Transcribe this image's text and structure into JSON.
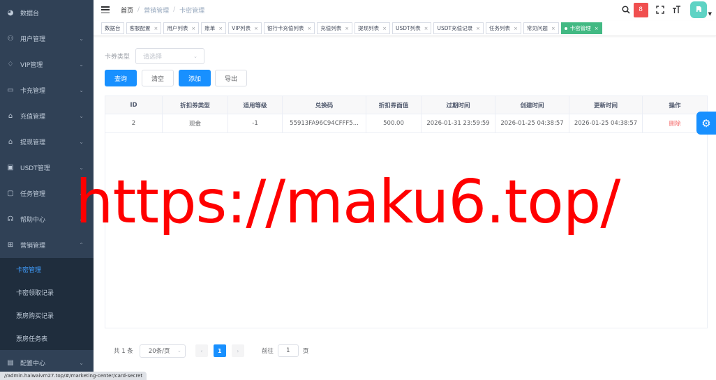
{
  "sidebar": {
    "items": [
      {
        "label": "数据台",
        "icon": "dashboard-icon",
        "chev": ""
      },
      {
        "label": "用户管理",
        "icon": "user-icon",
        "chev": "⌄"
      },
      {
        "label": "VIP管理",
        "icon": "vip-icon",
        "chev": "⌄"
      },
      {
        "label": "卡充管理",
        "icon": "card-icon",
        "chev": "⌄"
      },
      {
        "label": "充值管理",
        "icon": "recharge-icon",
        "chev": "⌄"
      },
      {
        "label": "提现管理",
        "icon": "withdraw-icon",
        "chev": "⌄"
      },
      {
        "label": "USDT管理",
        "icon": "usdt-icon",
        "chev": "⌄"
      },
      {
        "label": "任务管理",
        "icon": "task-icon",
        "chev": "⌄"
      },
      {
        "label": "帮助中心",
        "icon": "help-icon",
        "chev": "⌄"
      },
      {
        "label": "营销管理",
        "icon": "gift-icon",
        "chev": "⌃"
      }
    ],
    "submenu": [
      "卡密管理",
      "卡密领取记录",
      "票房购买记录",
      "票房任务表"
    ],
    "bottom": {
      "label": "配置中心",
      "icon": "config-icon",
      "chev": "⌄"
    }
  },
  "header": {
    "breadcrumb": [
      "首页",
      "营销管理",
      "卡密管理"
    ],
    "badge_text": "8"
  },
  "tags": [
    {
      "label": "数据台",
      "closable": false
    },
    {
      "label": "客服配置",
      "closable": true
    },
    {
      "label": "用户列表",
      "closable": true
    },
    {
      "label": "账单",
      "closable": true
    },
    {
      "label": "VIP列表",
      "closable": true
    },
    {
      "label": "银行卡充值列表",
      "closable": true
    },
    {
      "label": "充值列表",
      "closable": true
    },
    {
      "label": "提现列表",
      "closable": true
    },
    {
      "label": "USDT列表",
      "closable": true
    },
    {
      "label": "USDT充值记录",
      "closable": true
    },
    {
      "label": "任务列表",
      "closable": true
    },
    {
      "label": "常见问题",
      "closable": true
    },
    {
      "label": "卡密管理",
      "closable": true,
      "active": true
    }
  ],
  "filter": {
    "label": "卡券类型",
    "placeholder": "请选择"
  },
  "buttons": {
    "search": "查询",
    "clear": "清空",
    "add": "添加",
    "export": "导出"
  },
  "table": {
    "headers": [
      "ID",
      "折扣券类型",
      "适用等级",
      "兑换码",
      "折扣券面值",
      "过期时间",
      "创建时间",
      "更新时间",
      "操作"
    ],
    "rows": [
      [
        "2",
        "现金",
        "-1",
        "55913FA96C94CFFF5...",
        "500.00",
        "2026-01-31 23:59:59",
        "2026-01-25 04:38:57",
        "2026-01-25 04:38:57",
        "删除"
      ]
    ]
  },
  "pagination": {
    "total": "共 1 条",
    "page_size": "20条/页",
    "current": "1",
    "goto_label": "前往",
    "goto_value": "1",
    "page_suffix": "页"
  },
  "watermark": "https://maku6.top/",
  "status_url": "//admin.haiwaivm27.top/#/marketing-center/card-secret",
  "colors": {
    "primary": "#1890ff",
    "sidebar": "#304156",
    "active_tag": "#42b983",
    "danger": "#f56c6c"
  }
}
